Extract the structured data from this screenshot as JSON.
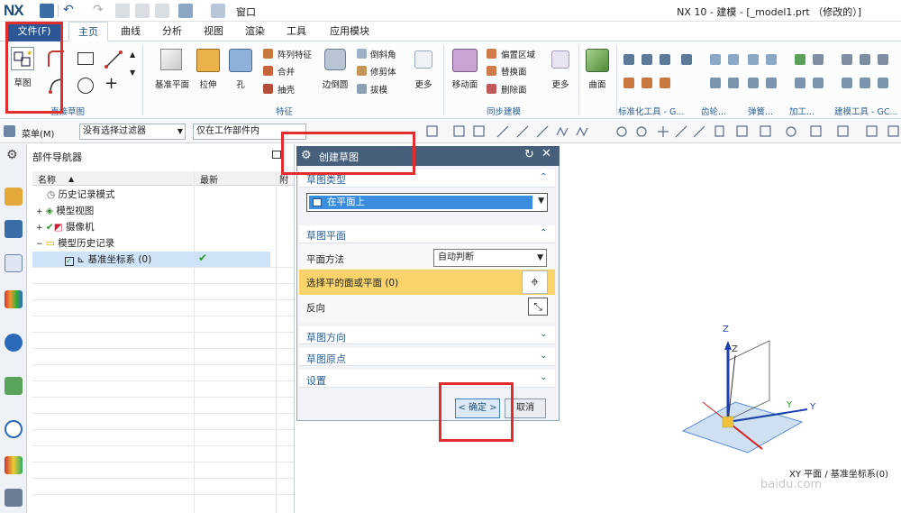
{
  "window": {
    "logo": "NX",
    "title": "NX 10 - 建模 - [_model1.prt （修改的）]",
    "quick_window_menu": "窗口"
  },
  "tabs": [
    "文件(F)",
    "主页",
    "曲线",
    "分析",
    "视图",
    "渲染",
    "工具",
    "应用模块"
  ],
  "ribbon": {
    "sketch": {
      "label": "草图",
      "group": "直接草图"
    },
    "feature": {
      "datum_plane": "基准平面",
      "extrude": "拉伸",
      "hole": "孔",
      "pattern": "阵列特征",
      "combine": "合并",
      "shell": "抽壳",
      "edge_blend": "边倒圆",
      "chamfer": "倒斜角",
      "trim_body": "修剪体",
      "draft": "拔模",
      "more": "更多",
      "group": "特征"
    },
    "sync": {
      "move_face": "移动面",
      "offset_region": "偏置区域",
      "replace_face": "替换面",
      "delete_face": "删除面",
      "more": "更多",
      "group": "同步建模"
    },
    "surface": {
      "label": "曲面"
    },
    "right_groups": [
      "标准化工具 - G...",
      "齿轮...",
      "弹簧...",
      "加工...",
      "建模工具 - GC..."
    ]
  },
  "toolbar2": {
    "menu": "菜单(M)",
    "filter": "没有选择过滤器",
    "scope": "仅在工作部件内"
  },
  "navigator": {
    "title": "部件导航器",
    "columns": {
      "name": "名称",
      "latest": "最新",
      "extra": "附"
    },
    "rows": [
      {
        "label": "历史记录模式"
      },
      {
        "label": "模型视图"
      },
      {
        "label": "摄像机"
      },
      {
        "label": "模型历史记录"
      },
      {
        "label": "基准坐标系 (0)"
      }
    ]
  },
  "dialog": {
    "title": "创建草图",
    "sketch_type": {
      "title": "草图类型",
      "value": "在平面上"
    },
    "sketch_plane": {
      "title": "草图平面",
      "method_label": "平面方法",
      "method_value": "自动判断",
      "select_label": "选择平的面或平面 (0)",
      "reverse_label": "反向"
    },
    "sketch_orientation": "草图方向",
    "sketch_origin": "草图原点",
    "settings": "设置",
    "ok": "< 确定 >",
    "cancel": "取消"
  },
  "viewport": {
    "status": "XY 平面 / 基准坐标系(0)",
    "watermark": "baidu.com",
    "axes": [
      "Z",
      "Z",
      "Y",
      "Y"
    ]
  },
  "colors": {
    "accent": "#2b5797",
    "dialog_title": "#46607c",
    "highlight": "#fad46a",
    "annotation": "#e12d2d",
    "selected_row": "#cfe3f7"
  }
}
